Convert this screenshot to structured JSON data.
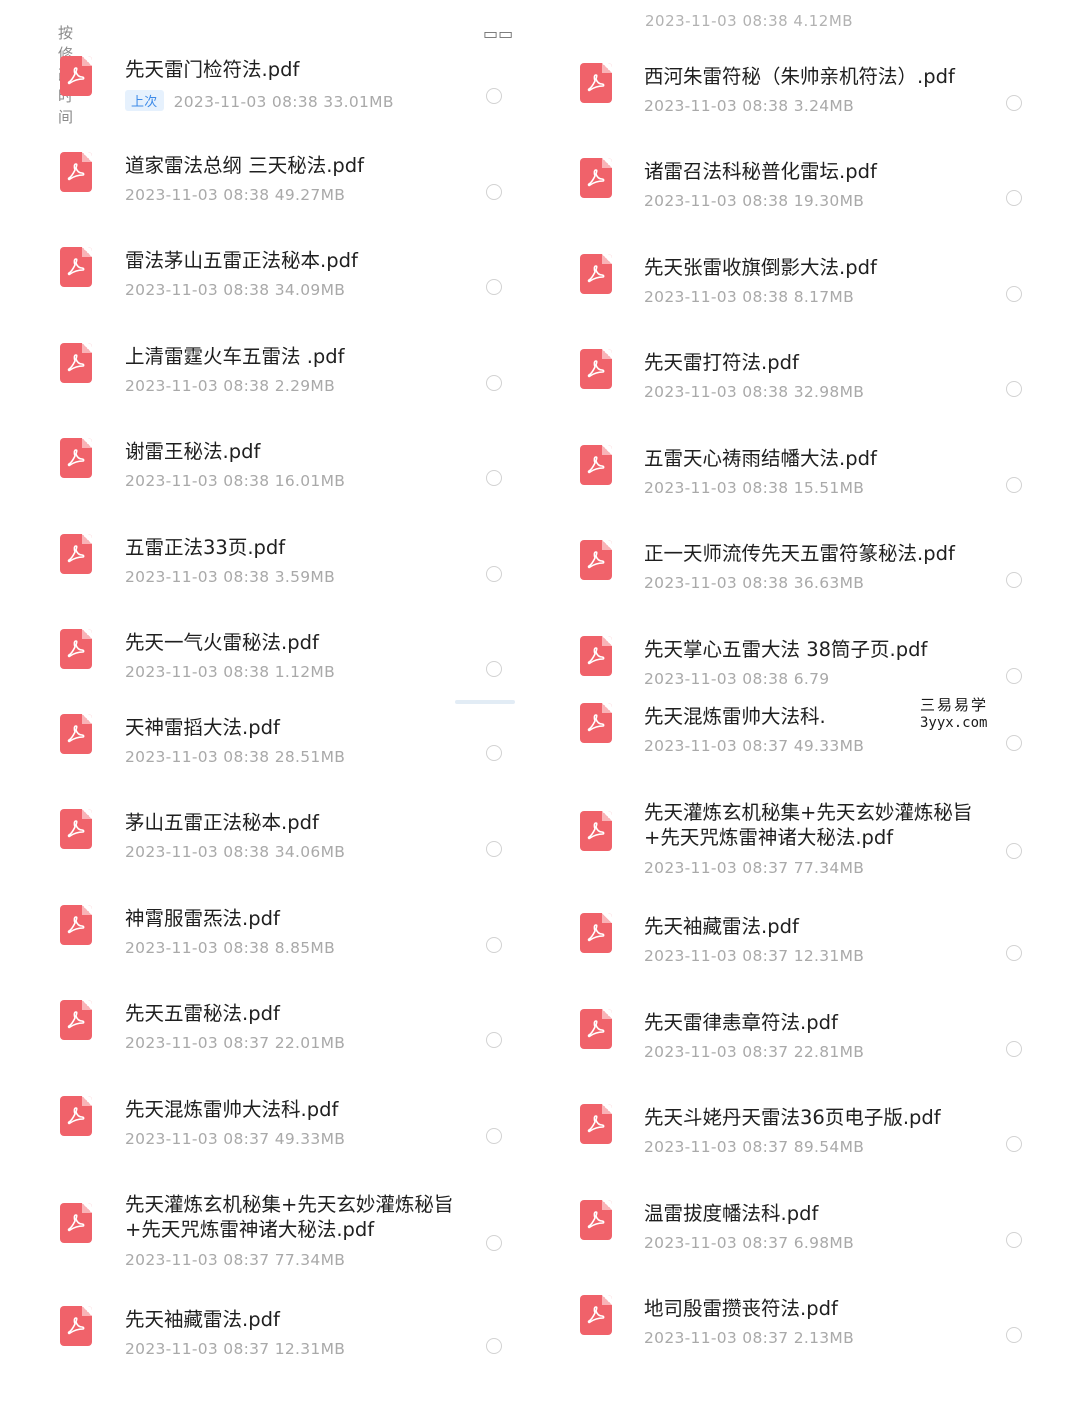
{
  "header": {
    "sort_label": "按修改时间",
    "view_icon": "grid-view-icon",
    "right_top_meta": "2023-11-03  08:38  4.12MB"
  },
  "watermark": {
    "line1": "三易易学",
    "line2": "3yyx.com"
  },
  "left_files": [
    {
      "name": "先天雷门检符法.pdf",
      "badge": "上次",
      "meta": "2023-11-03  08:38  33.01MB"
    },
    {
      "name": "道家雷法总纲 三天秘法.pdf",
      "meta": "2023-11-03  08:38  49.27MB"
    },
    {
      "name": "雷法茅山五雷正法秘本.pdf",
      "meta": "2023-11-03  08:38  34.09MB"
    },
    {
      "name": "上清雷霆火车五雷法 .pdf",
      "meta": "2023-11-03  08:38  2.29MB"
    },
    {
      "name": "谢雷王秘法.pdf",
      "meta": "2023-11-03  08:38  16.01MB"
    },
    {
      "name": "五雷正法33页.pdf",
      "meta": "2023-11-03  08:38  3.59MB"
    },
    {
      "name": "先天一气火雷秘法.pdf",
      "meta": "2023-11-03  08:38  1.12MB"
    },
    {
      "name": "天神雷搯大法.pdf",
      "meta": "2023-11-03  08:38  28.51MB"
    },
    {
      "name": "茅山五雷正法秘本.pdf",
      "meta": "2023-11-03  08:38  34.06MB"
    },
    {
      "name": "神霄服雷炁法.pdf",
      "meta": "2023-11-03  08:38  8.85MB"
    },
    {
      "name": "先天五雷秘法.pdf",
      "meta": "2023-11-03  08:37  22.01MB"
    },
    {
      "name": "先天混炼雷帅大法科.pdf",
      "meta": "2023-11-03  08:37  49.33MB"
    },
    {
      "name": "先天灌炼玄机秘集+先天玄妙灌炼秘旨",
      "name2": "+先天咒炼雷神诸大秘法.pdf",
      "meta": "2023-11-03  08:37  77.34MB"
    },
    {
      "name": "先天袖藏雷法.pdf",
      "meta": "2023-11-03  08:37  12.31MB"
    }
  ],
  "right_files": [
    {
      "name": "西河朱雷符秘（朱帅亲机符法）.pdf",
      "meta": "2023-11-03  08:38  3.24MB"
    },
    {
      "name": "诸雷召法科秘普化雷坛.pdf",
      "meta": "2023-11-03  08:38  19.30MB"
    },
    {
      "name": "先天张雷收旗倒影大法.pdf",
      "meta": "2023-11-03  08:38  8.17MB"
    },
    {
      "name": "先天雷打符法.pdf",
      "meta": "2023-11-03  08:38  32.98MB"
    },
    {
      "name": "五雷天心祷雨结幡大法.pdf",
      "meta": "2023-11-03  08:38  15.51MB"
    },
    {
      "name": "正一天师流传先天五雷符篆秘法.pdf",
      "meta": "2023-11-03  08:38  36.63MB"
    },
    {
      "name": "先天掌心五雷大法 38筒子页.pdf",
      "meta": "2023-11-03  08:38  6.79"
    },
    {
      "name": "先天混炼雷帅大法科.",
      "meta": "2023-11-03  08:37  49.33MB"
    },
    {
      "name": "先天灌炼玄机秘集+先天玄妙灌炼秘旨",
      "name2": "+先天咒炼雷神诸大秘法.pdf",
      "meta": "2023-11-03  08:37  77.34MB"
    },
    {
      "name": "先天袖藏雷法.pdf",
      "meta": "2023-11-03  08:37  12.31MB"
    },
    {
      "name": "先天雷律恚章符法.pdf",
      "meta": "2023-11-03  08:37  22.81MB"
    },
    {
      "name": "先天斗姥丹天雷法36页电子版.pdf",
      "meta": "2023-11-03  08:37  89.54MB"
    },
    {
      "name": "温雷拔度幡法科.pdf",
      "meta": "2023-11-03  08:37  6.98MB"
    },
    {
      "name": "地司殷雷攒丧符法.pdf",
      "meta": "2023-11-03  08:37  2.13MB"
    }
  ]
}
